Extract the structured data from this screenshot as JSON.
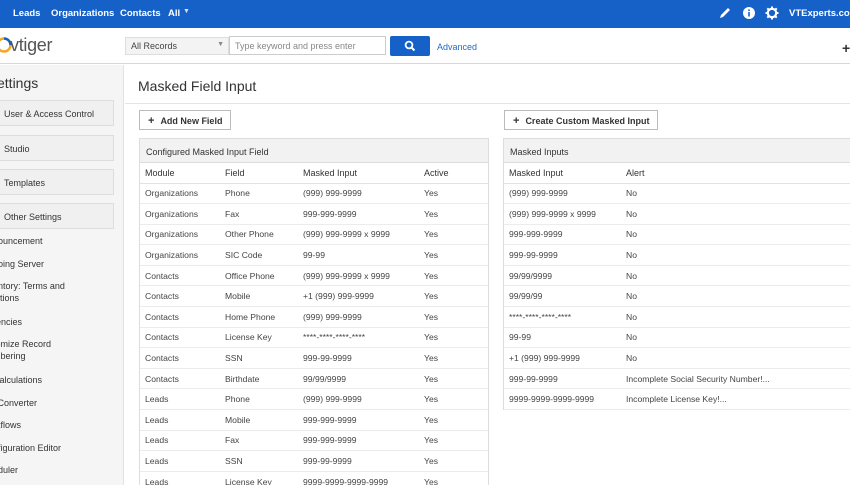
{
  "topnav": {
    "items": [
      "Leads",
      "Organizations",
      "Contacts",
      "All"
    ],
    "brand": "VTExperts.com"
  },
  "header": {
    "logo_text": "vtiger",
    "search_scope": "All Records",
    "search_placeholder": "Type keyword and press enter",
    "advanced_label": "Advanced"
  },
  "sidebar": {
    "title": "ettings",
    "sections": [
      "User & Access Control",
      "Studio",
      "Templates",
      "Other Settings"
    ],
    "items": [
      [
        "nouncement"
      ],
      [
        "going Server"
      ],
      [
        "entory: Terms and",
        "ditions"
      ],
      [
        "rencies"
      ],
      [
        "tomize Record",
        "mbering"
      ],
      [
        "Calculations"
      ],
      [
        "l Converter"
      ],
      [
        "rkflows"
      ],
      [
        "nfiguration Editor"
      ],
      [
        "eduler"
      ]
    ]
  },
  "main": {
    "title": "Masked Field Input",
    "add_button": "Add New Field",
    "create_button": "Create Custom Masked Input",
    "configured": {
      "title": "Configured Masked Input Field",
      "columns": [
        "Module",
        "Field",
        "Masked Input",
        "Active"
      ],
      "rows": [
        [
          "Organizations",
          "Phone",
          "(999) 999-9999",
          "Yes"
        ],
        [
          "Organizations",
          "Fax",
          "999-999-9999",
          "Yes"
        ],
        [
          "Organizations",
          "Other Phone",
          "(999) 999-9999 x 9999",
          "Yes"
        ],
        [
          "Organizations",
          "SIC Code",
          "99-99",
          "Yes"
        ],
        [
          "Contacts",
          "Office Phone",
          "(999) 999-9999 x 9999",
          "Yes"
        ],
        [
          "Contacts",
          "Mobile",
          "+1 (999) 999-9999",
          "Yes"
        ],
        [
          "Contacts",
          "Home Phone",
          "(999) 999-9999",
          "Yes"
        ],
        [
          "Contacts",
          "License Key",
          "****-****-****-****",
          "Yes"
        ],
        [
          "Contacts",
          "SSN",
          "999-99-9999",
          "Yes"
        ],
        [
          "Contacts",
          "Birthdate",
          "99/99/9999",
          "Yes"
        ],
        [
          "Leads",
          "Phone",
          "(999) 999-9999",
          "Yes"
        ],
        [
          "Leads",
          "Mobile",
          "999-999-9999",
          "Yes"
        ],
        [
          "Leads",
          "Fax",
          "999-999-9999",
          "Yes"
        ],
        [
          "Leads",
          "SSN",
          "999-99-9999",
          "Yes"
        ],
        [
          "Leads",
          "License Key",
          "9999-9999-9999-9999",
          "Yes"
        ]
      ]
    },
    "masked": {
      "title": "Masked Inputs",
      "columns": [
        "Masked Input",
        "Alert"
      ],
      "rows": [
        [
          "(999) 999-9999",
          "No"
        ],
        [
          "(999) 999-9999 x 9999",
          "No"
        ],
        [
          "999-999-9999",
          "No"
        ],
        [
          "999-99-9999",
          "No"
        ],
        [
          "99/99/9999",
          "No"
        ],
        [
          "99/99/99",
          "No"
        ],
        [
          "****-****-****-****",
          "No"
        ],
        [
          "99-99",
          "No"
        ],
        [
          "+1 (999) 999-9999",
          "No"
        ],
        [
          "999-99-9999",
          "Incomplete Social Security Number!..."
        ],
        [
          "9999-9999-9999-9999",
          "Incomplete License Key!..."
        ]
      ]
    }
  },
  "colors": {
    "topbar": "#1661c8",
    "link": "#1f6bc7"
  }
}
